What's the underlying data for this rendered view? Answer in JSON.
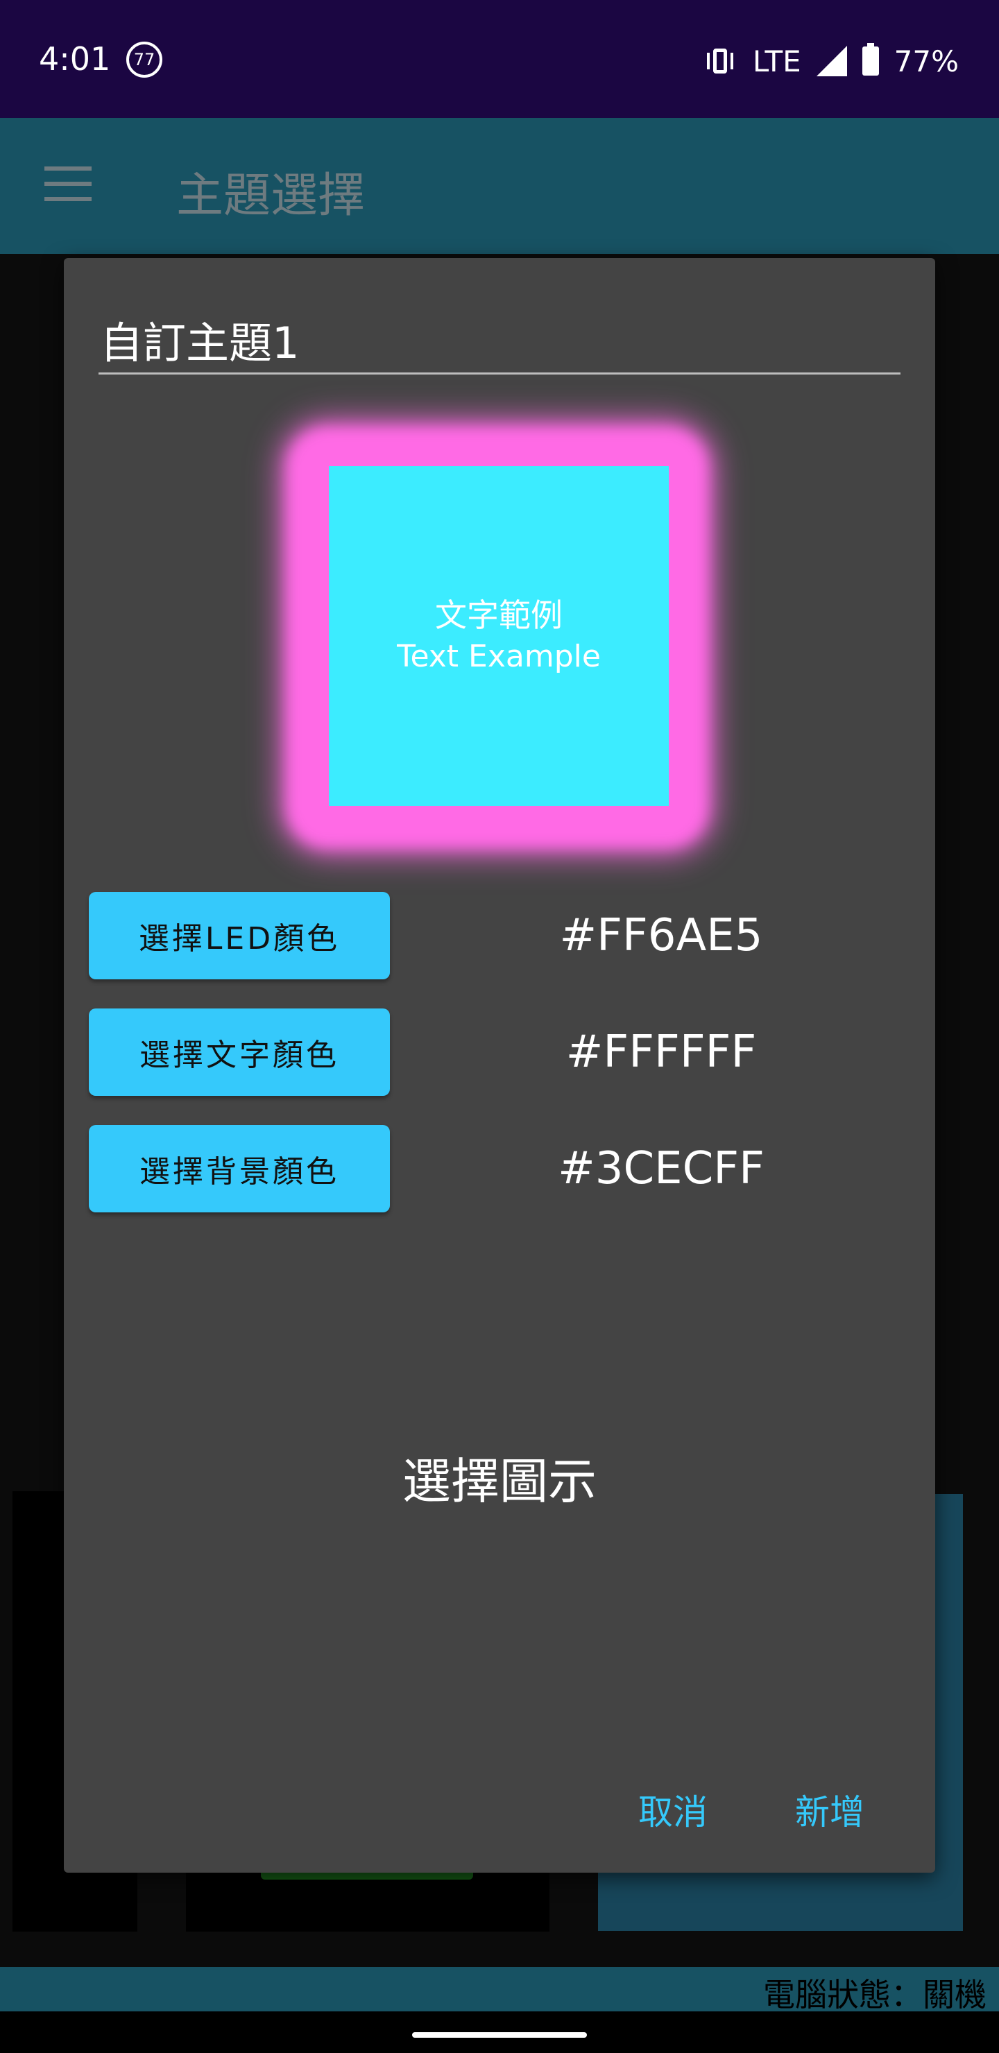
{
  "status_bar": {
    "time": "4:01",
    "notification_badge": "77",
    "network": "LTE",
    "battery": "77%"
  },
  "app_bar": {
    "title": "主題選擇",
    "menu_icon": "hamburger-menu-icon"
  },
  "dialog": {
    "theme_name": "自訂主題1",
    "preview": {
      "line1": "文字範例",
      "line2": "Text Example",
      "led_color": "#FF6AE5",
      "text_color": "#FFFFFF",
      "background_color": "#3CECFF"
    },
    "color_rows": [
      {
        "button_label": "選擇LED顏色",
        "value": "#FF6AE5"
      },
      {
        "button_label": "選擇文字顏色",
        "value": "#FFFFFF"
      },
      {
        "button_label": "選擇背景顏色",
        "value": "#3CECFF"
      }
    ],
    "choose_icon_label": "選擇圖示",
    "cancel_label": "取消",
    "add_label": "新增"
  },
  "footer": {
    "status_text": "電腦狀態：關機"
  }
}
